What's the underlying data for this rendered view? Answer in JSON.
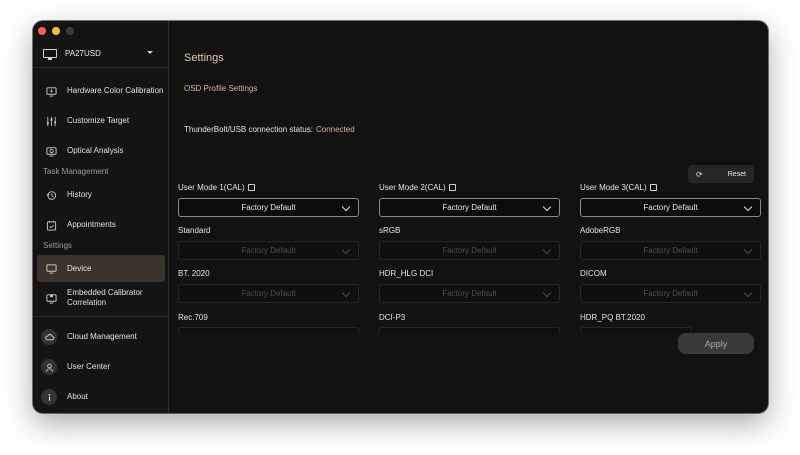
{
  "sidebar": {
    "device_name": "PA27USD",
    "items": {
      "hardware_color_calibration": "Hardware Color Calibration",
      "customize_target": "Customize Target",
      "optical_analysis": "Optical Analysis",
      "history": "History",
      "appointments": "Appointments",
      "device": "Device",
      "embedded_calibrator_correlation_l1": "Embedded Calibrator",
      "embedded_calibrator_correlation_l2": "Correlation",
      "cloud_management": "Cloud Management",
      "user_center": "User Center",
      "about": "About"
    },
    "sections": {
      "task_management": "Task Management",
      "settings": "Settings"
    },
    "active_item": "device"
  },
  "main": {
    "title": "Settings",
    "section_title": "OSD Profile Settings",
    "status_label": "ThunderBolt/USB connection status:",
    "status_value": "Connected",
    "reset_label": "Reset",
    "apply_label": "Apply",
    "modes": [
      {
        "label": "User Mode 1(CAL)",
        "value": "Factory Default",
        "enabled": true,
        "editable": true
      },
      {
        "label": "User Mode 2(CAL)",
        "value": "Factory Default",
        "enabled": true,
        "editable": true
      },
      {
        "label": "User Mode 3(CAL)",
        "value": "Factory Default",
        "enabled": true,
        "editable": true
      },
      {
        "label": "Standard",
        "value": "Factory Default",
        "enabled": false
      },
      {
        "label": "sRGB",
        "value": "Factory Default",
        "enabled": false
      },
      {
        "label": "AdobeRGB",
        "value": "Factory Default",
        "enabled": false
      },
      {
        "label": "BT. 2020",
        "value": "Factory Default",
        "enabled": false
      },
      {
        "label": "HDR_HLG DCI",
        "value": "Factory Default",
        "enabled": false
      },
      {
        "label": "DICOM",
        "value": "Factory Default",
        "enabled": false
      },
      {
        "label": "Rec.709",
        "value": "",
        "enabled": false
      },
      {
        "label": "DCI-P3",
        "value": "",
        "enabled": false
      },
      {
        "label": "HDR_PQ BT.2020",
        "value": "",
        "enabled": false
      }
    ]
  },
  "colors": {
    "accent": "#d9b98a",
    "active_bg": "#3a342c",
    "window_bg": "#121212"
  }
}
